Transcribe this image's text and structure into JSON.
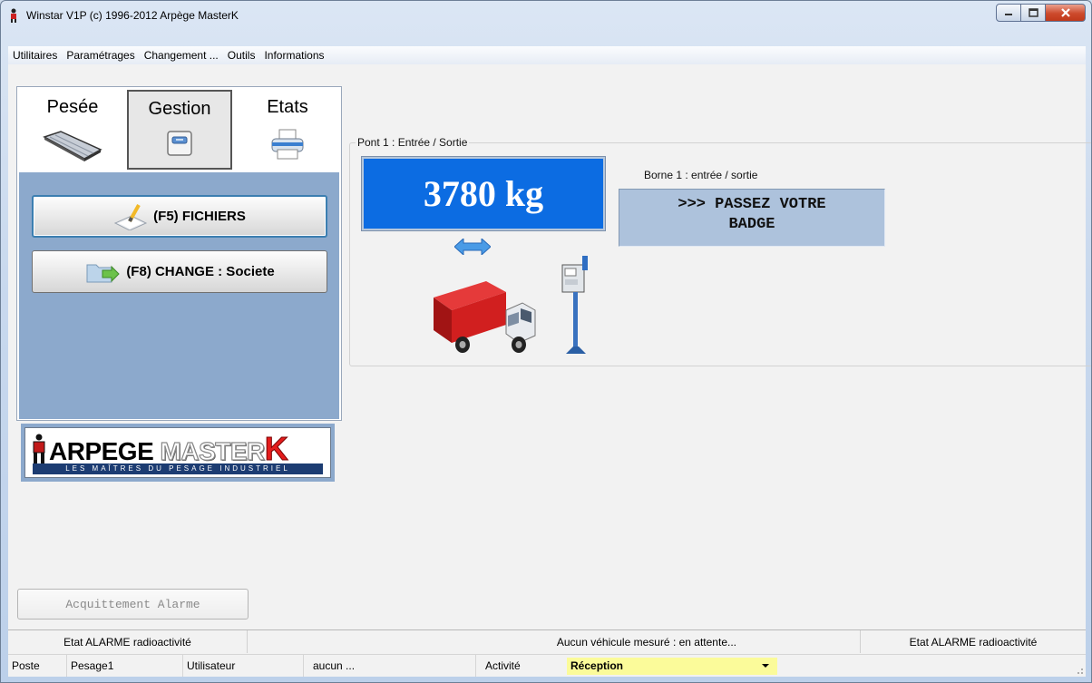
{
  "window": {
    "title": "Winstar V1P (c) 1996-2012 Arpège MasterK"
  },
  "menu": [
    "Utilitaires",
    "Paramétrages",
    "Changement ...",
    "Outils",
    "Informations"
  ],
  "tabs": {
    "pesee": "Pesée",
    "gestion": "Gestion",
    "etats": "Etats"
  },
  "actions": {
    "fichiers": "(F5) FICHIERS",
    "change": "(F8) CHANGE : Societe"
  },
  "logo": {
    "part1": "ARPEGE ",
    "part2": "MASTER",
    "part3": "K",
    "tagline": "LES MAÎTRES DU PESAGE INDUSTRIEL"
  },
  "bridge": {
    "title": "Pont 1 : Entrée / Sortie",
    "weight": "3780 kg",
    "borne_label": "Borne 1 : entrée / sortie",
    "borne_message": ">>> PASSEZ VOTRE\nBADGE"
  },
  "alarm_button": "Acquittement Alarme",
  "status": {
    "left": "Etat ALARME radioactivité",
    "center": "Aucun véhicule mesuré : en attente...",
    "right": "Etat ALARME radioactivité"
  },
  "footer": {
    "poste_label": "Poste",
    "poste_value": "Pesage1",
    "user_label": "Utilisateur",
    "user_value": "aucun ...",
    "activity_label": "Activité",
    "activity_value": "Réception"
  },
  "colors": {
    "weight_bg": "#0c6ce2",
    "panel_bg": "#8ca9cc",
    "borne_bg": "#adc2dc",
    "activity_bg": "#fbfb9a"
  }
}
